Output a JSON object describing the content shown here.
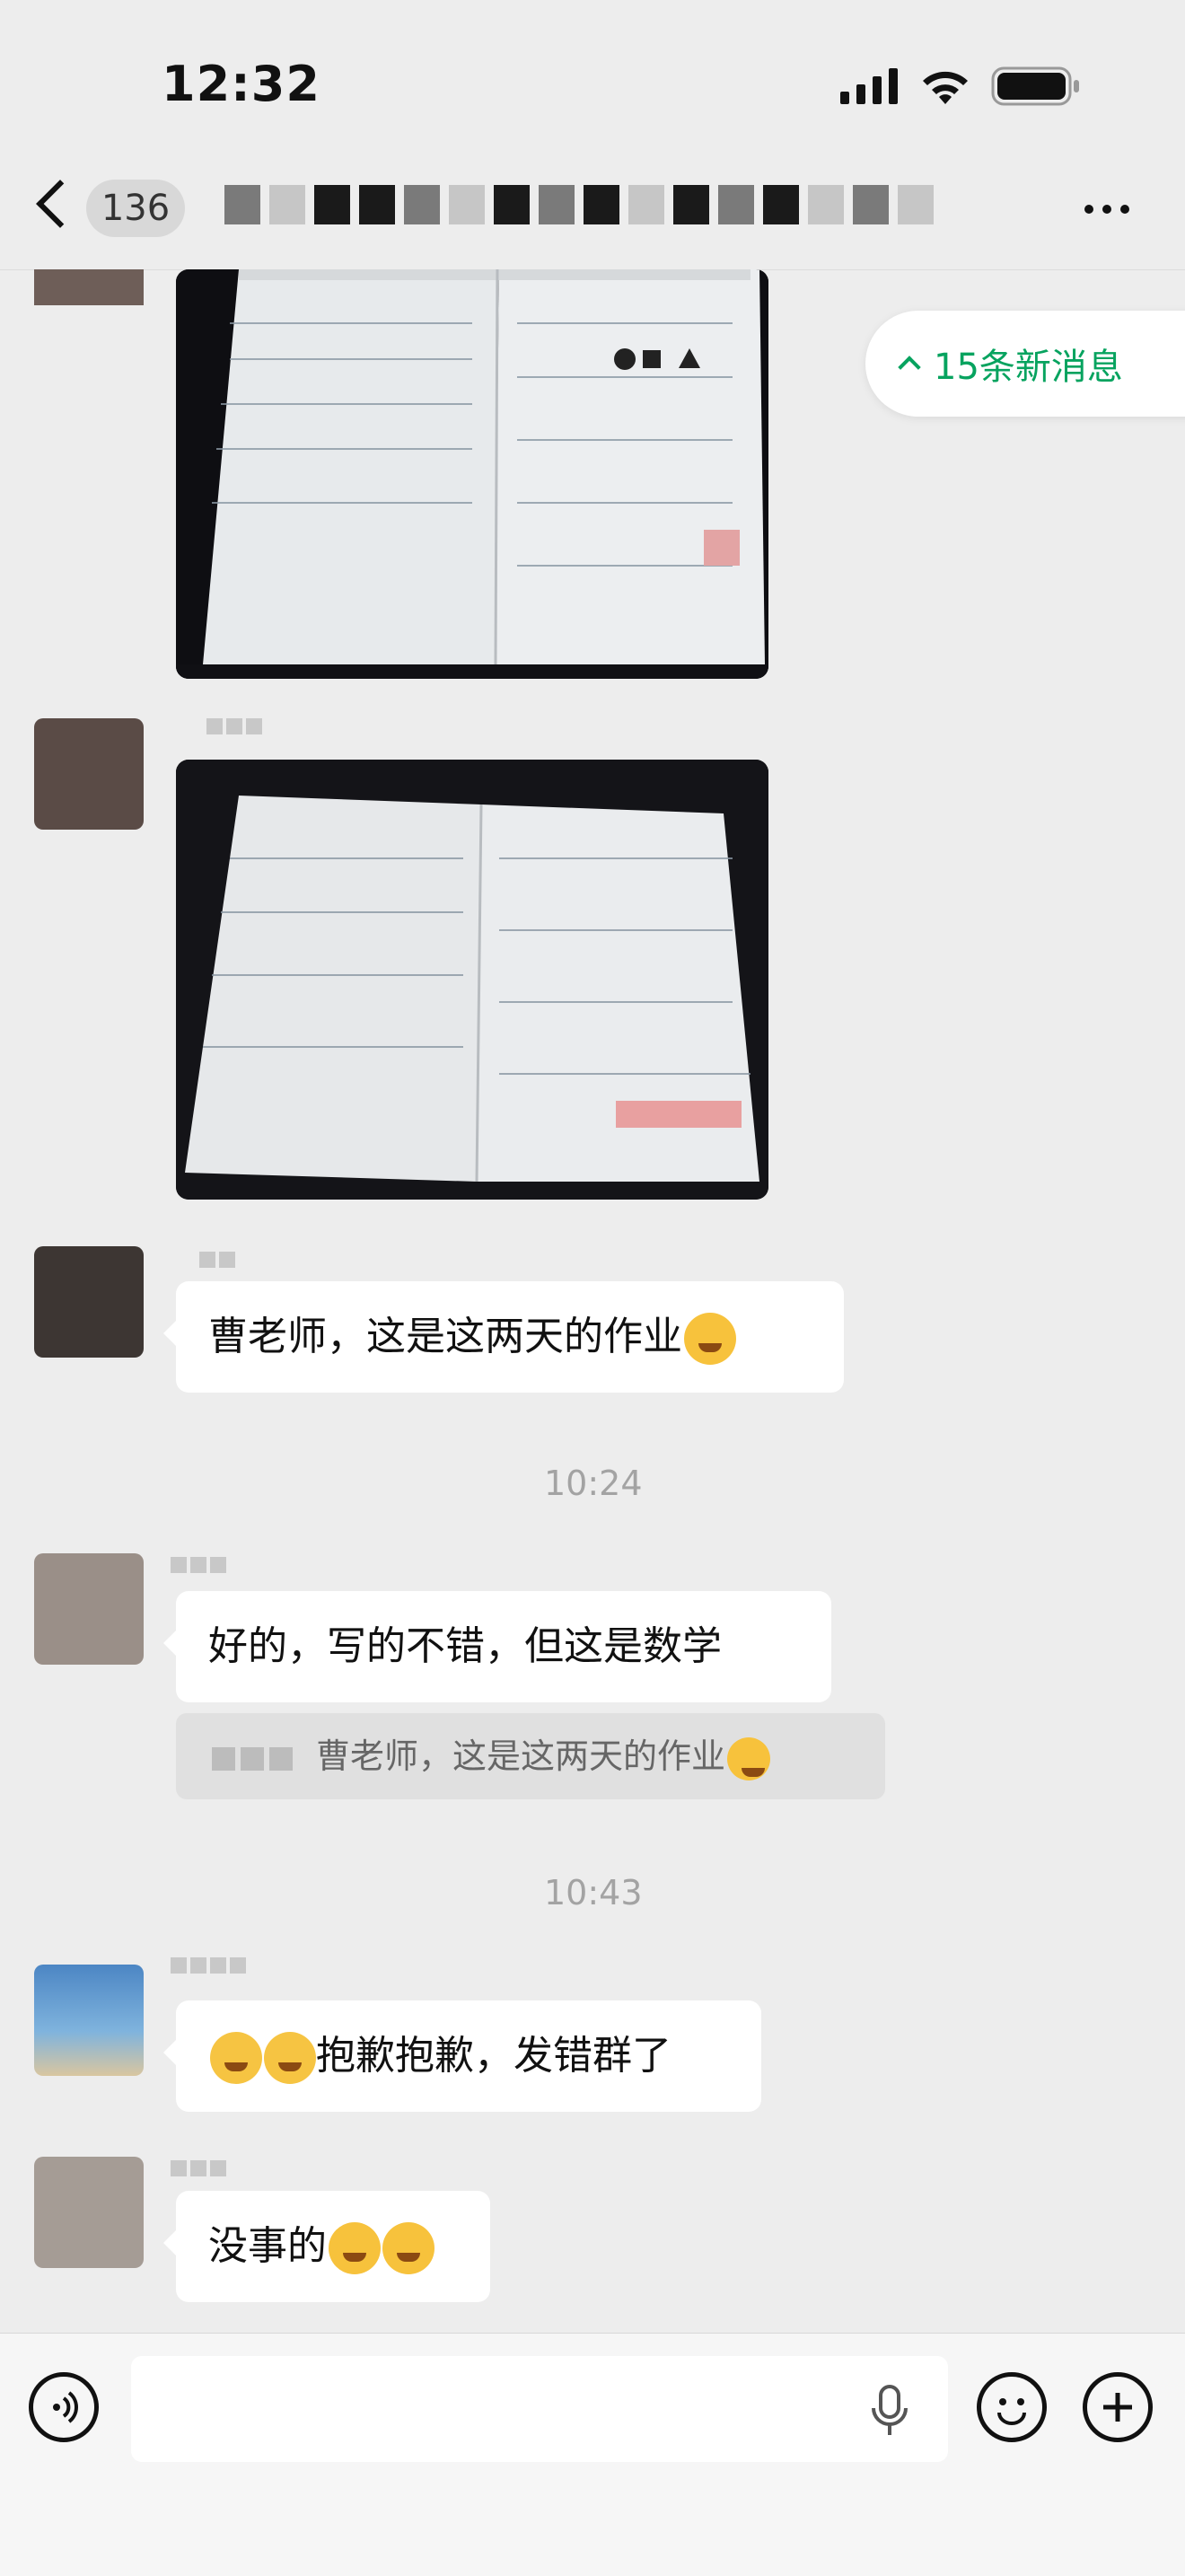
{
  "status_bar": {
    "time": "12:32"
  },
  "nav": {
    "badge": "136"
  },
  "new_messages": {
    "label": "15条新消息"
  },
  "messages": [
    {
      "type": "text",
      "text": "曹老师，这是这两天的作业"
    },
    {
      "type": "timestamp",
      "text": "10:24"
    },
    {
      "type": "text",
      "text": "好的，写的不错，但这是数学",
      "quote": "曹老师，这是这两天的作业"
    },
    {
      "type": "timestamp",
      "text": "10:43"
    },
    {
      "type": "text",
      "text": "抱歉抱歉，发错群了"
    },
    {
      "type": "text",
      "text": "没事的"
    }
  ]
}
